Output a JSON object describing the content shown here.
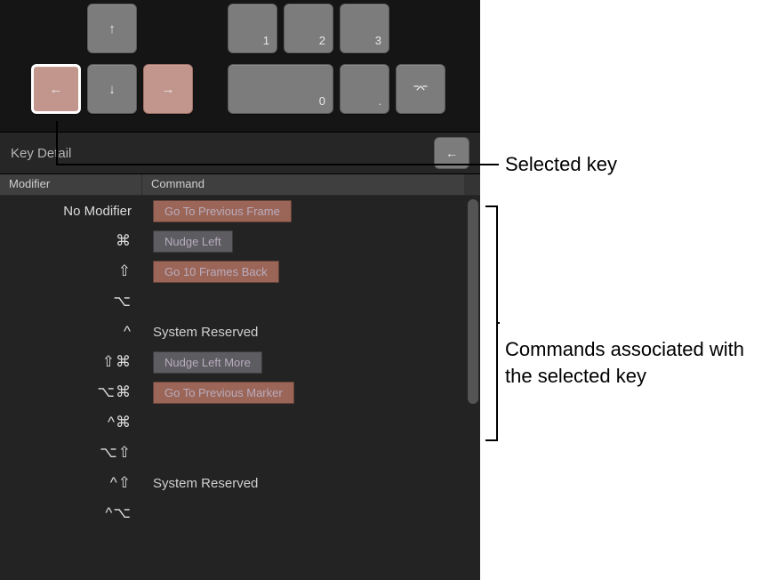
{
  "keyboard": {
    "up": "↑",
    "left": "←",
    "down": "↓",
    "right": "→",
    "numpad": {
      "k0": "0",
      "k1": "1",
      "k2": "2",
      "k3": "3",
      "dot": ".",
      "enter": "⌤"
    }
  },
  "key_detail": {
    "title": "Key Detail",
    "active_key": "←",
    "columns": {
      "modifier": "Modifier",
      "command": "Command"
    },
    "rows": [
      {
        "modifier": "No Modifier",
        "type": "chip",
        "chip": "rose",
        "label": "Go To Previous Frame"
      },
      {
        "modifier": "⌘",
        "type": "chip",
        "chip": "gray",
        "label": "Nudge Left"
      },
      {
        "modifier": "⇧",
        "type": "chip",
        "chip": "rose",
        "label": "Go 10 Frames Back"
      },
      {
        "modifier": "⌥",
        "type": "empty"
      },
      {
        "modifier": "^",
        "type": "reserved",
        "label": "System Reserved"
      },
      {
        "modifier": "⇧⌘",
        "type": "chip",
        "chip": "gray",
        "label": "Nudge Left More"
      },
      {
        "modifier": "⌥⌘",
        "type": "chip",
        "chip": "rose",
        "label": "Go To Previous Marker"
      },
      {
        "modifier": "^⌘",
        "type": "empty"
      },
      {
        "modifier": "⌥⇧",
        "type": "empty"
      },
      {
        "modifier": "^⇧",
        "type": "reserved",
        "label": "System Reserved"
      },
      {
        "modifier": "^⌥",
        "type": "empty"
      }
    ]
  },
  "callouts": {
    "selected_key": "Selected key",
    "commands": "Commands associated with the selected key"
  }
}
